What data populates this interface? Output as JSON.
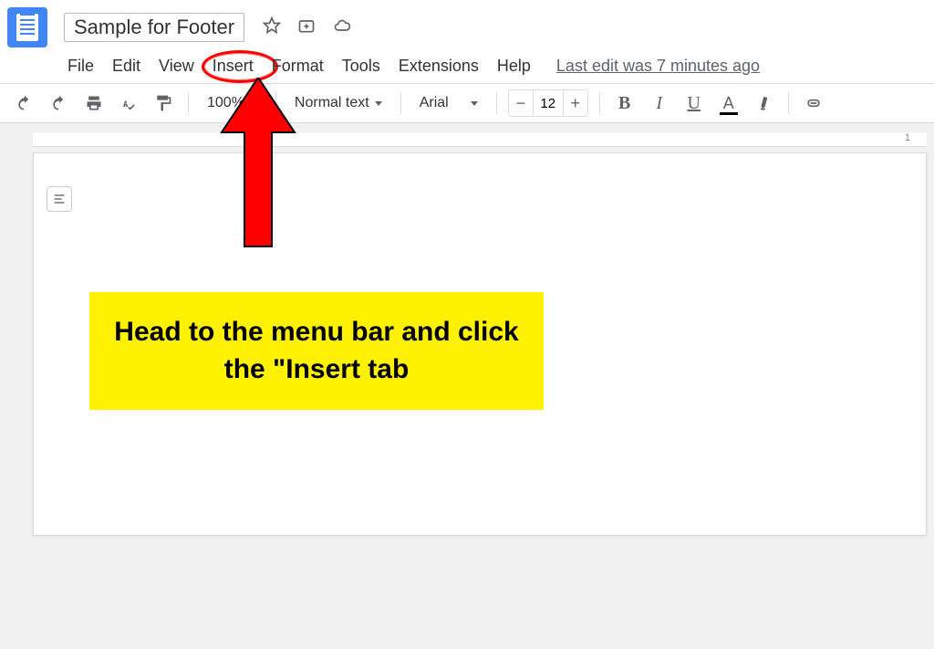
{
  "header": {
    "doc_title": "Sample for Footer",
    "menu": {
      "file": "File",
      "edit": "Edit",
      "view": "View",
      "insert": "Insert",
      "format": "Format",
      "tools": "Tools",
      "extensions": "Extensions",
      "help": "Help"
    },
    "last_edit": "Last edit was 7 minutes ago"
  },
  "toolbar": {
    "zoom": "100%",
    "style": "Normal text",
    "font": "Arial",
    "font_size": "12"
  },
  "ruler": {
    "mark": "1"
  },
  "callout": {
    "text": "Head to the menu bar and click the \"Insert tab"
  }
}
